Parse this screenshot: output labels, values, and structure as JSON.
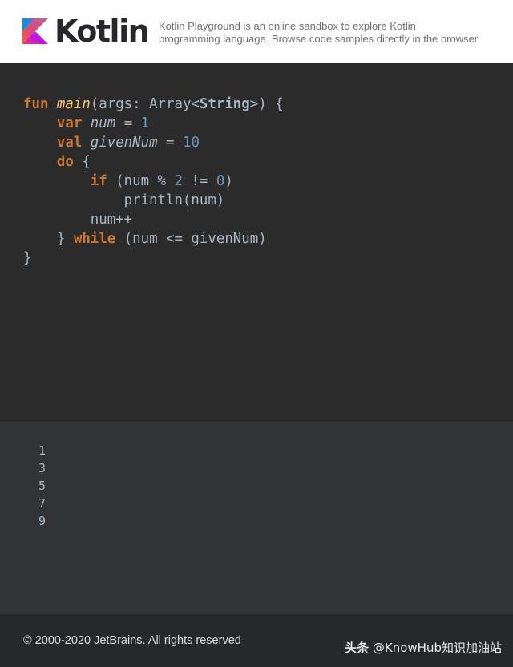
{
  "header": {
    "logo_text": "Kotlin",
    "tagline_line1": "Kotlin Playground is an online sandbox to explore Kotlin",
    "tagline_line2": "programming language. Browse code samples directly in the browser"
  },
  "editor": {
    "language": "Kotlin",
    "tokens": {
      "fun": "fun",
      "main": "main",
      "args_open": "(args: Array<",
      "string_type": "String",
      "args_close": ">) {",
      "var": "var",
      "num_name": "num",
      "assign": " = ",
      "one": "1",
      "val": "val",
      "givenNum_name": "givenNum",
      "ten": "10",
      "do": "do",
      "open_brace": " {",
      "if": "if",
      "if_cond_a": " (num % ",
      "two": "2",
      "if_cond_b": " != ",
      "zero": "0",
      "if_cond_c": ")",
      "println": "println(num)",
      "increment": "num++",
      "close_brace": "} ",
      "while": "while",
      "while_cond": " (num <= givenNum)",
      "final_brace": "}"
    }
  },
  "output": {
    "lines": [
      "1",
      "3",
      "5",
      "7",
      "9"
    ]
  },
  "footer": {
    "copyright": "© 2000-2020 JetBrains. All rights reserved",
    "watermark_prefix": "头条",
    "watermark_handle": "@KnowHub知识加油站"
  },
  "colors": {
    "keyword": "#cc7832",
    "function_name": "#ffc66d",
    "number": "#6897bb",
    "default_text": "#a9b7c6",
    "editor_bg": "#2b2b2b",
    "output_bg": "#313335",
    "footer_bg": "#27282c"
  },
  "icons": {
    "logo": "kotlin-logo-icon"
  }
}
